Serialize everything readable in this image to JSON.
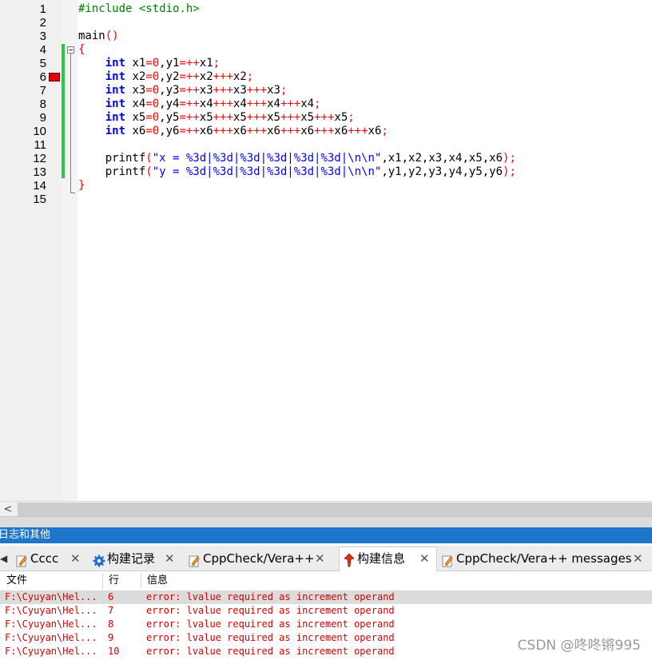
{
  "editor": {
    "lines": [
      {
        "n": "1",
        "tokens": [
          [
            "pp",
            "#include <stdio.h>"
          ]
        ]
      },
      {
        "n": "2",
        "tokens": []
      },
      {
        "n": "3",
        "tokens": [
          [
            "id",
            "main"
          ],
          [
            "op",
            "()"
          ]
        ]
      },
      {
        "n": "4",
        "tokens": [
          [
            "op",
            "{"
          ]
        ]
      },
      {
        "n": "5",
        "tokens": [
          [
            "id",
            "    "
          ],
          [
            "kw",
            "int"
          ],
          [
            "id",
            " x1"
          ],
          [
            "op",
            "=0"
          ],
          [
            "id",
            ",y1"
          ],
          [
            "op",
            "=++"
          ],
          [
            "id",
            "x1"
          ],
          [
            "op",
            ";"
          ]
        ]
      },
      {
        "n": "6",
        "tokens": [
          [
            "id",
            "    "
          ],
          [
            "kw",
            "int"
          ],
          [
            "id",
            " x2"
          ],
          [
            "op",
            "=0"
          ],
          [
            "id",
            ",y2"
          ],
          [
            "op",
            "=++"
          ],
          [
            "id",
            "x2"
          ],
          [
            "op",
            "+++"
          ],
          [
            "id",
            "x2"
          ],
          [
            "op",
            ";"
          ]
        ]
      },
      {
        "n": "7",
        "tokens": [
          [
            "id",
            "    "
          ],
          [
            "kw",
            "int"
          ],
          [
            "id",
            " x3"
          ],
          [
            "op",
            "=0"
          ],
          [
            "id",
            ",y3"
          ],
          [
            "op",
            "=++"
          ],
          [
            "id",
            "x3"
          ],
          [
            "op",
            "+++"
          ],
          [
            "id",
            "x3"
          ],
          [
            "op",
            "+++"
          ],
          [
            "id",
            "x3"
          ],
          [
            "op",
            ";"
          ]
        ]
      },
      {
        "n": "8",
        "tokens": [
          [
            "id",
            "    "
          ],
          [
            "kw",
            "int"
          ],
          [
            "id",
            " x4"
          ],
          [
            "op",
            "=0"
          ],
          [
            "id",
            ",y4"
          ],
          [
            "op",
            "=++"
          ],
          [
            "id",
            "x4"
          ],
          [
            "op",
            "+++"
          ],
          [
            "id",
            "x4"
          ],
          [
            "op",
            "+++"
          ],
          [
            "id",
            "x4"
          ],
          [
            "op",
            "+++"
          ],
          [
            "id",
            "x4"
          ],
          [
            "op",
            ";"
          ]
        ]
      },
      {
        "n": "9",
        "tokens": [
          [
            "id",
            "    "
          ],
          [
            "kw",
            "int"
          ],
          [
            "id",
            " x5"
          ],
          [
            "op",
            "=0"
          ],
          [
            "id",
            ",y5"
          ],
          [
            "op",
            "=++"
          ],
          [
            "id",
            "x5"
          ],
          [
            "op",
            "+++"
          ],
          [
            "id",
            "x5"
          ],
          [
            "op",
            "+++"
          ],
          [
            "id",
            "x5"
          ],
          [
            "op",
            "+++"
          ],
          [
            "id",
            "x5"
          ],
          [
            "op",
            "+++"
          ],
          [
            "id",
            "x5"
          ],
          [
            "op",
            ";"
          ]
        ]
      },
      {
        "n": "10",
        "tokens": [
          [
            "id",
            "    "
          ],
          [
            "kw",
            "int"
          ],
          [
            "id",
            " x6"
          ],
          [
            "op",
            "=0"
          ],
          [
            "id",
            ",y6"
          ],
          [
            "op",
            "=++"
          ],
          [
            "id",
            "x6"
          ],
          [
            "op",
            "+++"
          ],
          [
            "id",
            "x6"
          ],
          [
            "op",
            "+++"
          ],
          [
            "id",
            "x6"
          ],
          [
            "op",
            "+++"
          ],
          [
            "id",
            "x6"
          ],
          [
            "op",
            "+++"
          ],
          [
            "id",
            "x6"
          ],
          [
            "op",
            "+++"
          ],
          [
            "id",
            "x6"
          ],
          [
            "op",
            ";"
          ]
        ]
      },
      {
        "n": "11",
        "tokens": []
      },
      {
        "n": "12",
        "tokens": [
          [
            "id",
            "    printf"
          ],
          [
            "op",
            "("
          ],
          [
            "str",
            "\"x = %3d|%3d|%3d|%3d|%3d|%3d|\\n\\n\""
          ],
          [
            "id",
            ",x1,x2,x3,x4,x5,x6"
          ],
          [
            "op",
            ");"
          ]
        ]
      },
      {
        "n": "13",
        "tokens": [
          [
            "id",
            "    printf"
          ],
          [
            "op",
            "("
          ],
          [
            "str",
            "\"y = %3d|%3d|%3d|%3d|%3d|%3d|\\n\\n\""
          ],
          [
            "id",
            ",y1,y2,y3,y4,y5,y6"
          ],
          [
            "op",
            ");"
          ]
        ]
      },
      {
        "n": "14",
        "tokens": [
          [
            "op",
            "}"
          ]
        ]
      },
      {
        "n": "15",
        "tokens": []
      }
    ],
    "breakpoint_line": "6"
  },
  "scrollbar": {
    "left_arrow": "<"
  },
  "panel": {
    "title": "日志和其他",
    "tab_arrow": "◀",
    "tabs": [
      {
        "label": "Cccc",
        "icon": "pencil-icon",
        "close": "✕"
      },
      {
        "label": "构建记录",
        "icon": "gear-icon",
        "close": "✕"
      },
      {
        "label": "CppCheck/Vera++",
        "icon": "pencil-icon",
        "close": "✕"
      },
      {
        "label": "构建信息",
        "icon": "marker-icon",
        "close": "✕",
        "active": true
      },
      {
        "label": "CppCheck/Vera++ messages",
        "icon": "pencil-icon",
        "close": "✕"
      }
    ],
    "columns": [
      "文件",
      "行",
      "信息"
    ],
    "rows": [
      {
        "file": "F:\\Cyuyan\\Hel...",
        "line": "6",
        "msg": "error: lvalue required as increment operand",
        "selected": true
      },
      {
        "file": "F:\\Cyuyan\\Hel...",
        "line": "7",
        "msg": "error: lvalue required as increment operand"
      },
      {
        "file": "F:\\Cyuyan\\Hel...",
        "line": "8",
        "msg": "error: lvalue required as increment operand"
      },
      {
        "file": "F:\\Cyuyan\\Hel...",
        "line": "9",
        "msg": "error: lvalue required as increment operand"
      },
      {
        "file": "F:\\Cyuyan\\Hel...",
        "line": "10",
        "msg": "error: lvalue required as increment operand"
      }
    ]
  },
  "watermark": "CSDN @咚咚锵995",
  "colors": {
    "keyword": "#0000ff",
    "operator": "#ff0000",
    "preprocessor": "#008000",
    "error_text": "#d40000",
    "panel_title_bg": "#1e75c9",
    "changebar": "#22cc44",
    "breakpoint": "#e00000"
  }
}
